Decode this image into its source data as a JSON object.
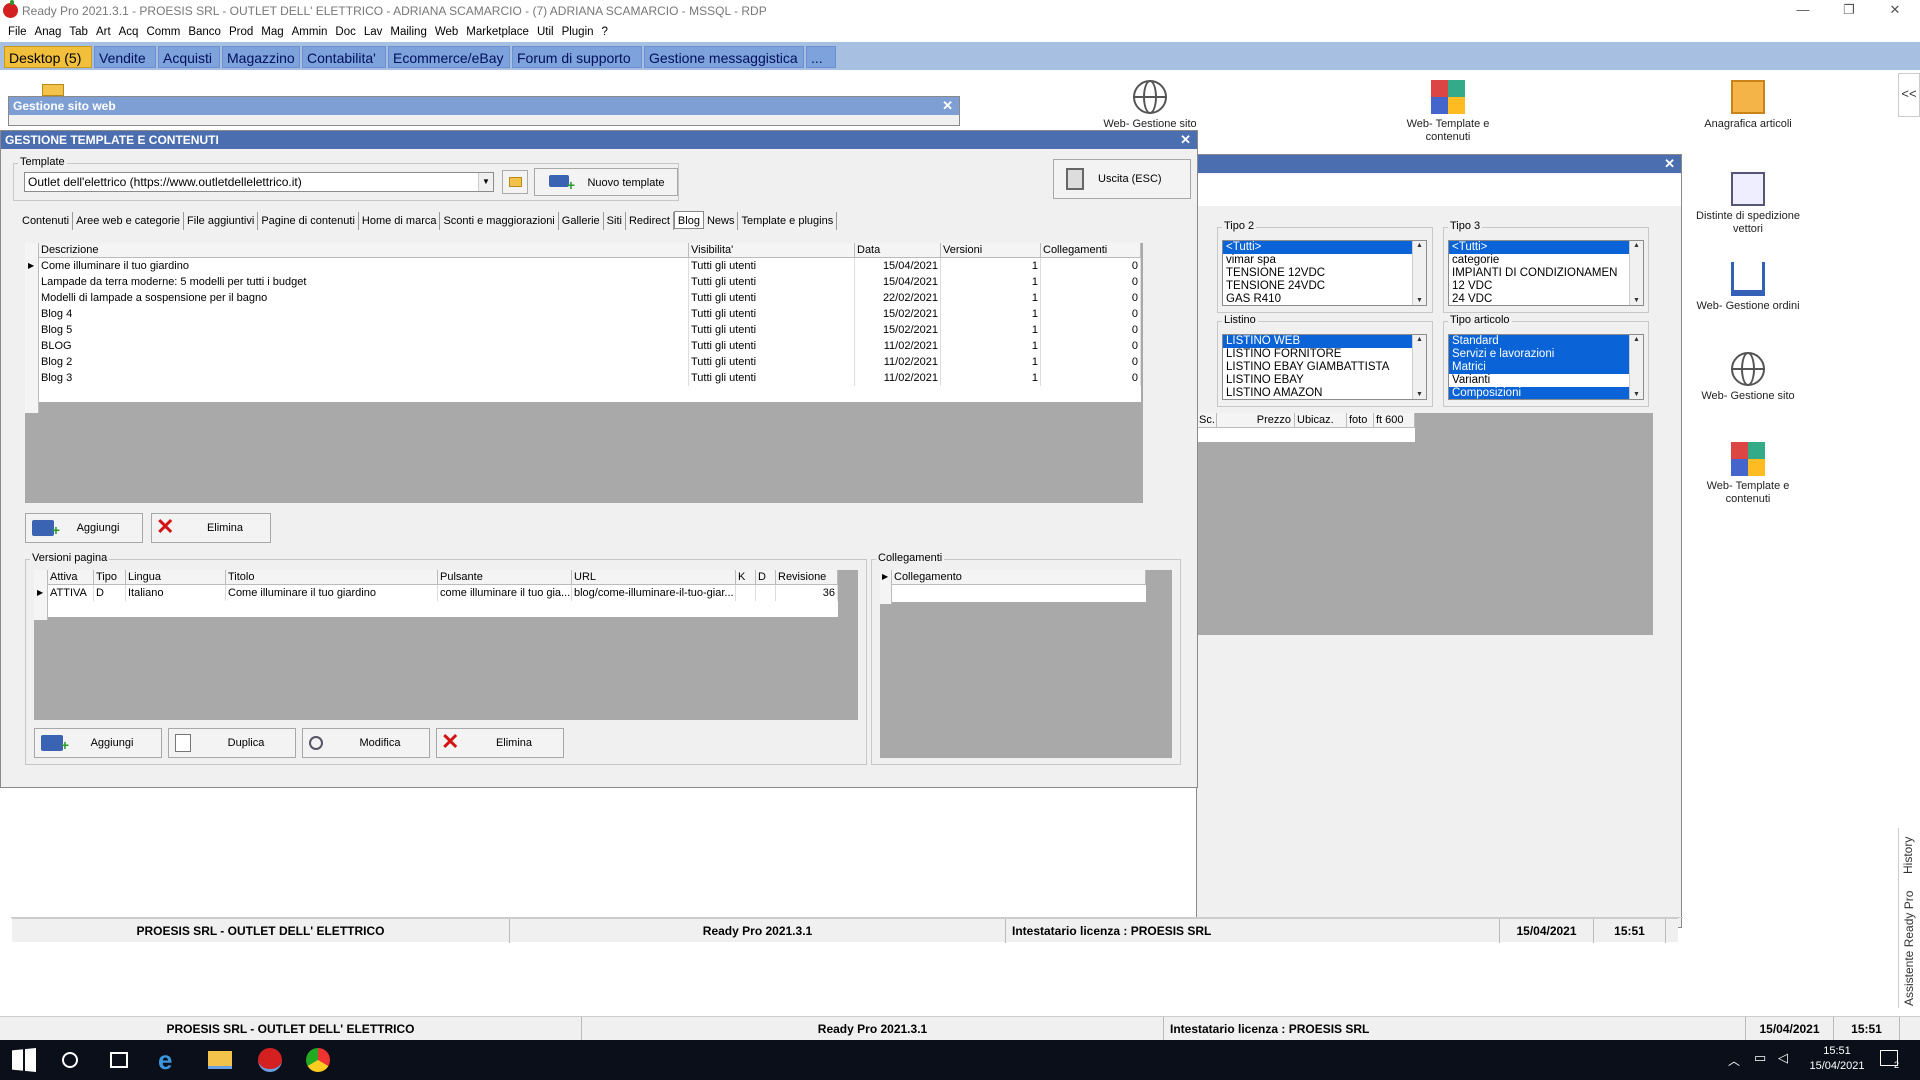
{
  "app": {
    "title": "Ready Pro 2021.3.1 - PROESIS SRL - OUTLET DELL' ELETTRICO - ADRIANA SCAMARCIO - (7) ADRIANA SCAMARCIO - MSSQL - RDP",
    "menu": [
      "File",
      "Anag",
      "Tab",
      "Art",
      "Acq",
      "Comm",
      "Banco",
      "Prod",
      "Mag",
      "Ammin",
      "Doc",
      "Lav",
      "Mailing",
      "Web",
      "Marketplace",
      "Util",
      "Plugin",
      "?"
    ],
    "tabs": [
      "Desktop (5)",
      "Vendite",
      "Acquisti",
      "Magazzino",
      "Contabilita'",
      "Ecommerce/eBay",
      "Forum di supporto",
      "Gestione messaggistica",
      "..."
    ]
  },
  "desktop": {
    "icons": [
      {
        "label": "Web- Gestione sito",
        "icon": "globe-icon"
      },
      {
        "label": "Web- Template e contenuti",
        "icon": "template-icon"
      },
      {
        "label": "Anagrafica articoli",
        "icon": "box-icon"
      },
      {
        "label": "Distinte di spedizione vettori",
        "icon": "document-icon"
      },
      {
        "label": "Web- Gestione ordini",
        "icon": "cart-icon"
      },
      {
        "label": "Web- Gestione sito",
        "icon": "globe-icon"
      },
      {
        "label": "Web- Template e contenuti",
        "icon": "template-icon"
      }
    ]
  },
  "sidepanel": {
    "history": "History",
    "assistant": "Assistente Ready Pro",
    "collapse": "<<"
  },
  "bgwin": {
    "title": "Gestione sito web",
    "tipo2": {
      "label": "Tipo 2",
      "items": [
        "<Tutti>",
        "vimar spa",
        "TENSIONE 12VDC",
        "TENSIONE 24VDC",
        "GAS R410"
      ]
    },
    "tipo3": {
      "label": "Tipo 3",
      "items": [
        "<Tutti>",
        "categorie",
        "IMPIANTI DI CONDIZIONAMEN",
        "12 VDC",
        "24 VDC"
      ]
    },
    "listino": {
      "label": "Listino",
      "items": [
        "LISTINO WEB",
        "LISTINO FORNITORE",
        "LISTINO EBAY GIAMBATTISTA",
        "LISTINO EBAY",
        "LISTINO AMAZON"
      ]
    },
    "tipoart": {
      "label": "Tipo articolo",
      "items": [
        "Standard",
        "Servizi e lavorazioni",
        "Matrici",
        "Varianti",
        "Composizioni"
      ]
    },
    "grid_headers": [
      "Sc.",
      "Prezzo",
      "Ubicaz.",
      "foto",
      "ft 600"
    ]
  },
  "main": {
    "title": "GESTIONE TEMPLATE E CONTENUTI",
    "template_label": "Template",
    "template_value": "Outlet dell'elettrico (https://www.outletdellelettrico.it)",
    "new_template": "Nuovo template",
    "exit": "Uscita (ESC)",
    "tabs": [
      "Contenuti",
      "Aree web e categorie",
      "File aggiuntivi",
      "Pagine di contenuti",
      "Home di marca",
      "Sconti e maggiorazioni",
      "Gallerie",
      "Siti",
      "Redirect",
      "Blog",
      "News",
      "Template e plugins"
    ],
    "grid": {
      "headers": [
        "Descrizione",
        "Visibilita'",
        "Data",
        "Versioni",
        "Collegamenti"
      ],
      "rows": [
        [
          "Come illuminare il tuo giardino",
          "Tutti gli utenti",
          "15/04/2021",
          "1",
          "0"
        ],
        [
          "Lampade da terra moderne: 5 modelli per tutti i budget",
          "Tutti gli utenti",
          "15/04/2021",
          "1",
          "0"
        ],
        [
          "Modelli di lampade a sospensione per il bagno",
          "Tutti gli utenti",
          "22/02/2021",
          "1",
          "0"
        ],
        [
          "Blog 4",
          "Tutti gli utenti",
          "15/02/2021",
          "1",
          "0"
        ],
        [
          "Blog 5",
          "Tutti gli utenti",
          "15/02/2021",
          "1",
          "0"
        ],
        [
          "BLOG",
          "Tutti gli utenti",
          "11/02/2021",
          "1",
          "0"
        ],
        [
          "Blog 2",
          "Tutti gli utenti",
          "11/02/2021",
          "1",
          "0"
        ],
        [
          "Blog 3",
          "Tutti gli utenti",
          "11/02/2021",
          "1",
          "0"
        ]
      ]
    },
    "add": "Aggiungi",
    "delete": "Elimina",
    "versions": {
      "label": "Versioni pagina",
      "headers": [
        "Attiva",
        "Tipo",
        "Lingua",
        "Titolo",
        "Pulsante",
        "URL",
        "K",
        "D",
        "Revisione"
      ],
      "rows": [
        [
          "ATTIVA",
          "D",
          "Italiano",
          "Come illuminare il tuo giardino",
          "come illuminare il tuo gia...",
          "blog/come-illuminare-il-tuo-giar...",
          "",
          "",
          "36"
        ]
      ],
      "add": "Aggiungi",
      "duplicate": "Duplica",
      "edit": "Modifica",
      "delete": "Elimina"
    },
    "links": {
      "label": "Collegamenti",
      "header": "Collegamento"
    }
  },
  "status1": [
    "PROESIS SRL - OUTLET DELL' ELETTRICO",
    "Ready Pro 2021.3.1",
    "Intestatario licenza : PROESIS SRL",
    "15/04/2021",
    "15:51"
  ],
  "status2": [
    "PROESIS SRL - OUTLET DELL' ELETTRICO",
    "Ready Pro 2021.3.1",
    "Intestatario licenza : PROESIS SRL",
    "15/04/2021",
    "15:51"
  ],
  "taskbar": {
    "time": "15:51",
    "date": "15/04/2021",
    "notif": "2"
  }
}
